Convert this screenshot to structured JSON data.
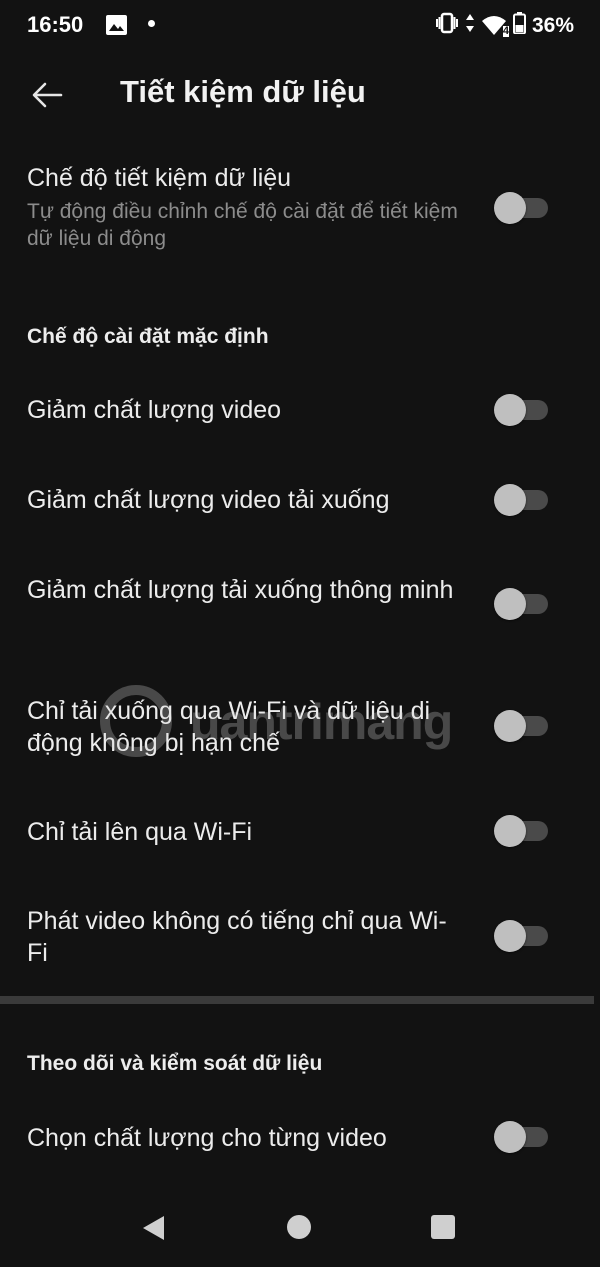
{
  "status_bar": {
    "time": "16:50",
    "battery_percent": "36%",
    "network_badge": "4",
    "icons": [
      "gallery-icon",
      "notification-dot",
      "vibrate-icon",
      "data-arrows-icon",
      "wifi-icon",
      "battery-icon"
    ]
  },
  "app_bar": {
    "back_icon": "arrow-left-icon",
    "title": "Tiết kiệm dữ liệu"
  },
  "main_setting": {
    "label": "Chế độ tiết kiệm dữ liệu",
    "description": "Tự động điều chỉnh chế độ cài đặt để tiết kiệm dữ liệu di động",
    "enabled": false
  },
  "sections": [
    {
      "header": "Chế độ cài đặt mặc định",
      "items": [
        {
          "label": "Giảm chất lượng video",
          "enabled": false
        },
        {
          "label": "Giảm chất lượng video tải xuống",
          "enabled": false
        },
        {
          "label": "Giảm chất lượng tải xuống thông minh",
          "enabled": false
        },
        {
          "label": "Chỉ tải xuống qua Wi-Fi và dữ liệu di động không bị hạn chế",
          "enabled": false
        },
        {
          "label": "Chỉ tải lên qua Wi-Fi",
          "enabled": false
        },
        {
          "label": "Phát video không có tiếng chỉ qua Wi-Fi",
          "enabled": false
        }
      ]
    },
    {
      "header": "Theo dõi và kiểm soát dữ liệu",
      "items": [
        {
          "label": "Chọn chất lượng cho từng video",
          "enabled": false
        }
      ]
    }
  ],
  "watermark": {
    "text": "uantrimang"
  },
  "nav_bar": {
    "icons": [
      "nav-back-icon",
      "nav-home-icon",
      "nav-recents-icon"
    ]
  },
  "colors": {
    "background": "#121212",
    "toggle_thumb": "#bfbfbf",
    "toggle_track": "#4a4a4a",
    "secondary_text": "#8c8c8c"
  }
}
